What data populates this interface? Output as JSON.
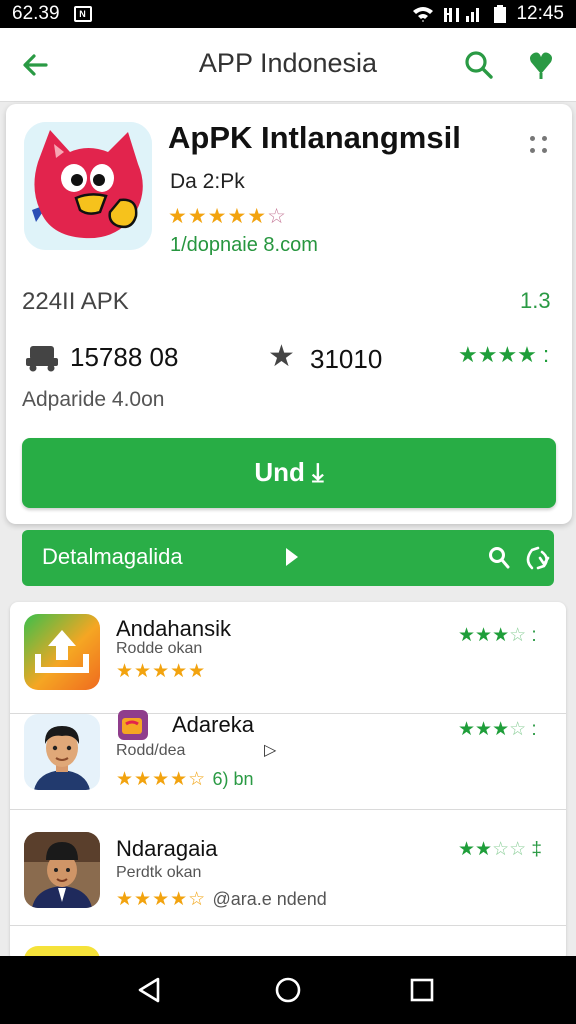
{
  "status": {
    "time_left": "62.39",
    "notif": "N",
    "time_right": "12:45"
  },
  "appbar": {
    "title": "APP Indonesia"
  },
  "app": {
    "name": "ApPK Intlanangmsil",
    "developer": "Da 2:Pk",
    "rating_stars": "★★★★★",
    "rating_off": "☆",
    "website": "1/dopnaie 8.com",
    "apk_label": "224II APK",
    "version": "1.3",
    "downloads": "15788 08",
    "star_count": "31010",
    "green_stars": "★★★★ :",
    "updated": "Adparide 4.0on",
    "update_button": "Und ⤓"
  },
  "detail_bar": {
    "label": "Detalmagalida"
  },
  "list": [
    {
      "name": "Andahansik",
      "sub": "Rodde okan",
      "stars": "★★★★★",
      "extra": "",
      "right_on": "★★★",
      "right_off": "☆",
      "right_k": " :"
    },
    {
      "name": "Adareka",
      "sub": "Rodd/dea",
      "stars": "★★★★☆",
      "extra": "6) bn",
      "right_on": "★★★",
      "right_off": "☆",
      "right_k": " :"
    },
    {
      "name": "Ndaragaia",
      "sub": "Perdtk okan",
      "stars": "★★★★☆",
      "extra": "@ara.e ndend",
      "right_on": "★★",
      "right_off": "☆☆",
      "right_k": " ‡"
    }
  ],
  "colors": {
    "brand_green": "#28ad45",
    "star_gold": "#f2a30f"
  }
}
